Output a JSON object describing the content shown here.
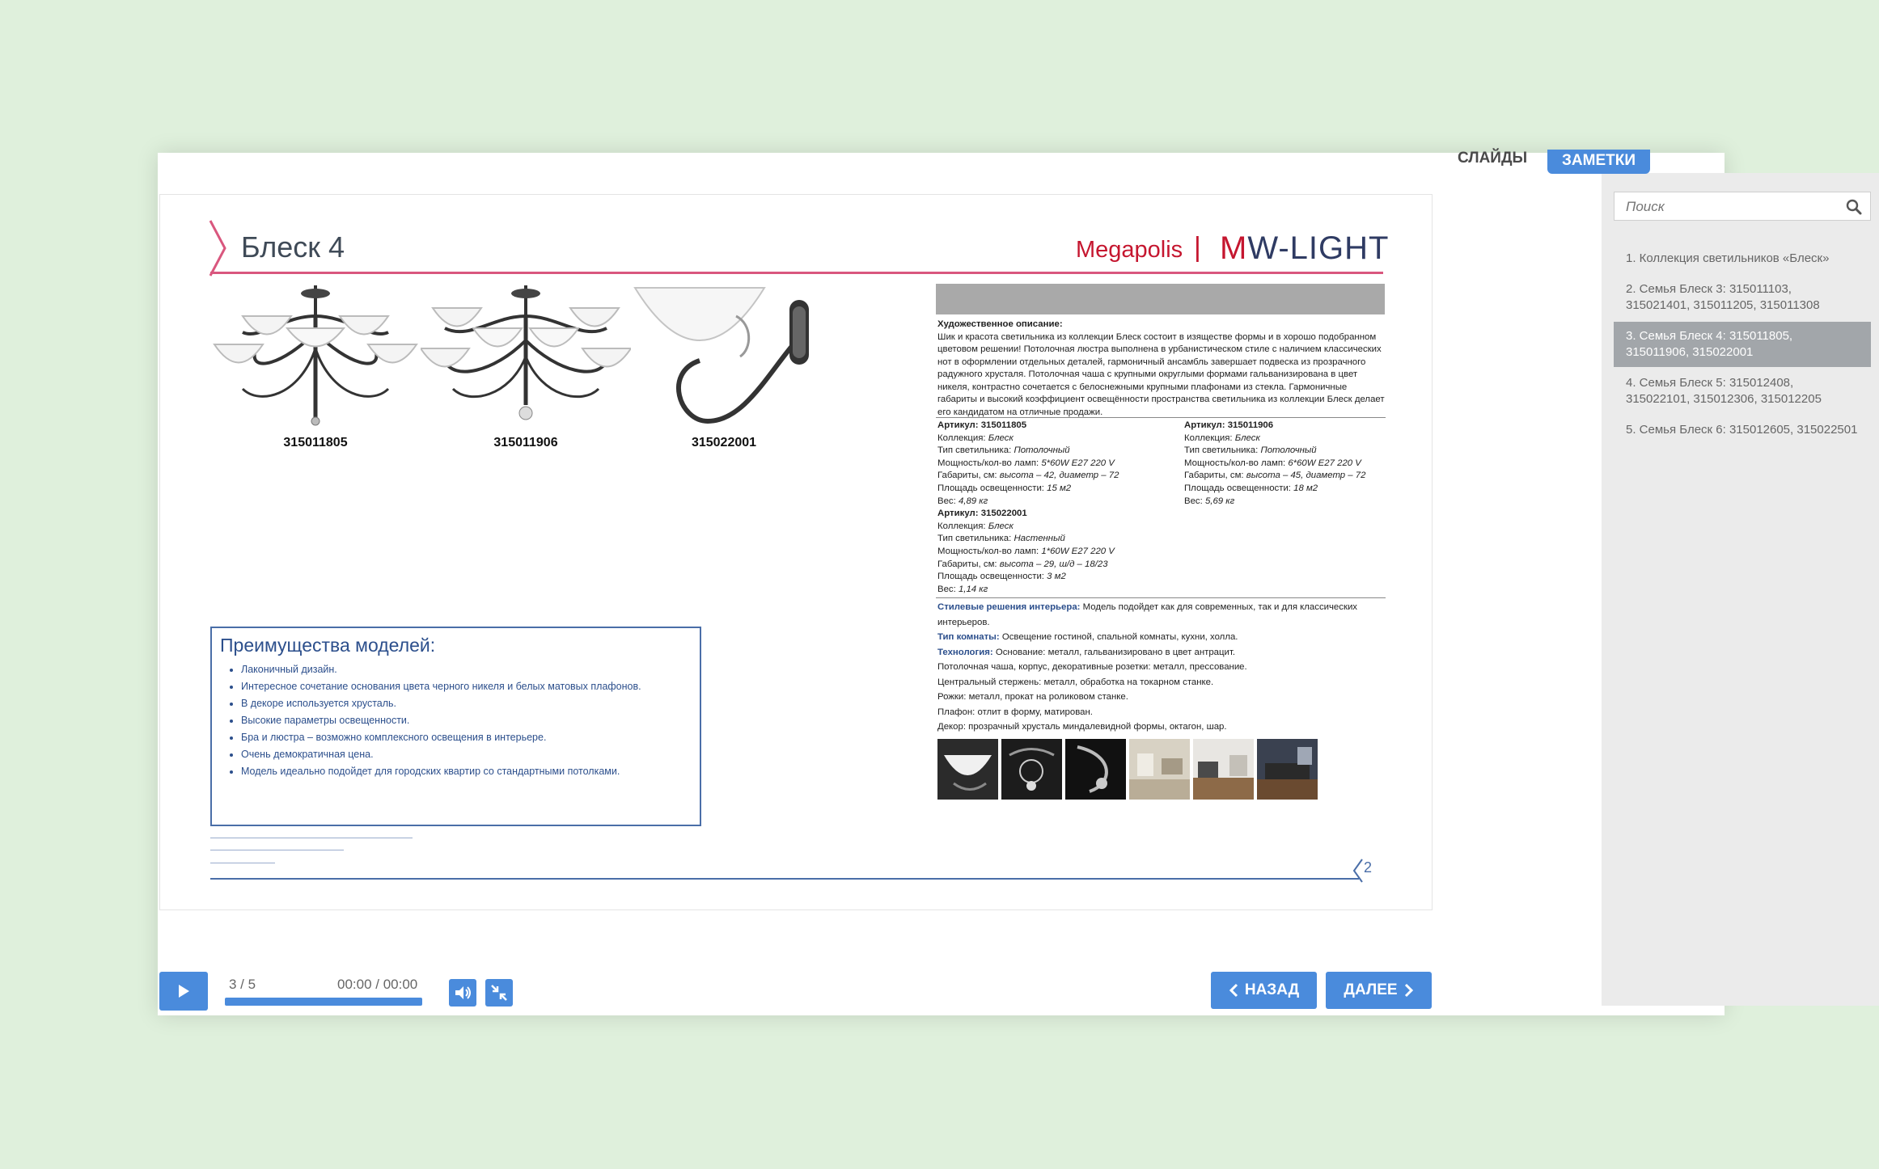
{
  "slide": {
    "title": "Блеск 4",
    "brand_left": "Megapolis",
    "brand_sep": "|",
    "brand_right_m": "M",
    "brand_right_rest": "W-LIGHT",
    "products": [
      {
        "code": "315011805"
      },
      {
        "code": "315011906"
      },
      {
        "code": "315022001"
      }
    ],
    "description_label": "Художественное описание:",
    "description": "Шик и красота светильника из коллекции Блеск состоит в изяществе формы и в хорошо подобранном цветовом решении! Потолочная люстра выполнена в урбанистическом стиле с наличием классических нот в оформлении отдельных деталей, гармоничный ансамбль завершает подвеска из прозрачного радужного хрусталя. Потолочная чаша с крупными округлыми формами гальванизирована в цвет никеля, контрастно сочетается с белоснежными крупными плафонами из стекла. Гармоничные габариты и высокий коэффициент освещённости пространства  светильника из коллекции Блеск делает его кандидатом на отличные продажи.",
    "specs": [
      {
        "header": "Артикул: 315011805",
        "collection_label": "Коллекция: ",
        "collection": "Блеск",
        "type_label": "Тип светильника: ",
        "type": "Потолочный",
        "power_label": "Мощность/кол-во ламп: ",
        "power": "5*60W E27 220 V",
        "dims_label": "Габариты, см: ",
        "dims": "высота – 42, диаметр – 72",
        "area_label": "Площадь освещенности: ",
        "area": "15 м2",
        "weight_label": "Вес:  ",
        "weight": "4,89 кг"
      },
      {
        "header": "Артикул: 315011906",
        "collection_label": "Коллекция: ",
        "collection": "Блеск",
        "type_label": "Тип светильника: ",
        "type": "Потолочный",
        "power_label": "Мощность/кол-во ламп: ",
        "power": "6*60W E27 220 V",
        "dims_label": "Габариты, см: ",
        "dims": "высота – 45, диаметр – 72",
        "area_label": "Площадь освещенности: ",
        "area": "18 м2",
        "weight_label": "Вес:  ",
        "weight": "5,69 кг"
      },
      {
        "header": "Артикул: 315022001",
        "collection_label": "Коллекция: ",
        "collection": "Блеск",
        "type_label": "Тип светильника: ",
        "type": "Настенный",
        "power_label": "Мощность/кол-во ламп: ",
        "power": "1*60W E27 220 V",
        "dims_label": "Габариты, см: ",
        "dims": "высота – 29, ш/д – 18/23",
        "area_label": "Площадь освещенности: ",
        "area": "3 м2",
        "weight_label": "Вес:  ",
        "weight": "1,14 кг"
      }
    ],
    "style_label": "Стилевые решения интерьера:",
    "style_text": " Модель подойдет как для современных, так и для классических интерьеров.",
    "room_label": "Тип комнаты:",
    "room_text": " Освещение гостиной, спальной комнаты, кухни, холла.",
    "tech_label": "Технология:",
    "tech_text": " Основание: металл, гальванизировано в цвет антрацит.",
    "tech_lines": [
      "Потолочная чаша, корпус, декоративные розетки: металл, прессование.",
      "Центральный стержень: металл, обработка на токарном станке.",
      "Рожки: металл, прокат на роликовом станке.",
      "Плафон: отлит в форму, матирован.",
      "Декор: прозрачный хрусталь миндалевидной формы, октагон, шар."
    ],
    "benefits_title": "Преимущества моделей:",
    "benefits": [
      "Лаконичный дизайн.",
      "Интересное сочетание основания цвета черного никеля и белых матовых плафонов.",
      "В декоре используется хрусталь.",
      "Высокие параметры освещенности.",
      "Бра и люстра – возможно комплексного освещения в интерьере.",
      "Очень демократичная цена.",
      "Модель идеально подойдет для  городских квартир со стандартными потолками."
    ],
    "page_number": "2"
  },
  "sidebar": {
    "tab_slides": "СЛАЙДЫ",
    "tab_notes": "ЗАМЕТКИ",
    "search_placeholder": "Поиск",
    "items": [
      {
        "label": "1. Коллекция светильников «Блеск»"
      },
      {
        "label": "2. Семья Блеск 3: 315011103, 315021401, 315011205, 315011308"
      },
      {
        "label": "3. Семья Блеск 4: 315011805, 315011906, 315022001"
      },
      {
        "label": "4. Семья Блеск 5: 315012408, 315022101, 315012306, 315012205"
      },
      {
        "label": "5. Семья Блеск 6: 315012605, 315022501"
      }
    ],
    "active_index": 2
  },
  "controls": {
    "counter": "3 / 5",
    "time": "00:00 / 00:00",
    "back_label": "НАЗАД",
    "next_label": "ДАЛЕЕ",
    "progress": 1.0
  },
  "colors": {
    "accent": "#4a8bdc",
    "brand_red": "#c5162f",
    "title_rule": "#d9577e",
    "benefits_blue": "#2c4f8c"
  }
}
